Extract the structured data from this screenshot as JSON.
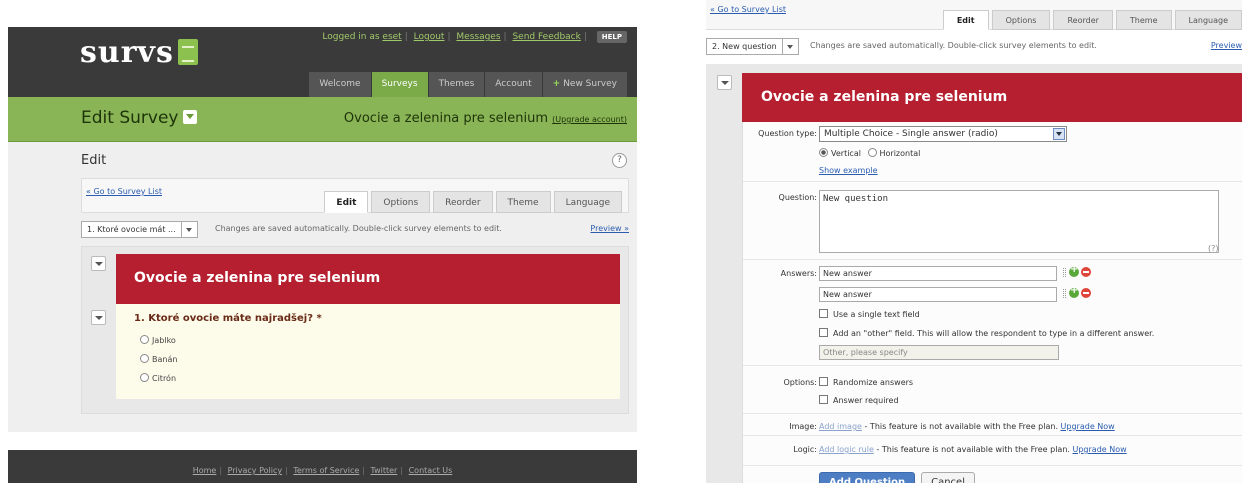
{
  "left": {
    "logo": "survs",
    "userbar": {
      "logged_in_as": "Logged in as",
      "username": "eset",
      "logout": "Logout",
      "messages": "Messages",
      "send_feedback": "Send Feedback",
      "help": "HELP"
    },
    "nav": {
      "welcome": "Welcome",
      "surveys": "Surveys",
      "themes": "Themes",
      "account": "Account",
      "new_survey_plus": "+",
      "new_survey": "New Survey"
    },
    "page_title": "Edit Survey",
    "survey_name": "Ovocie a zelenina pre selenium",
    "upgrade_link": "(Upgrade account)",
    "section_title": "Edit",
    "help_icon": "?",
    "go_to_list": "« Go to Survey List",
    "tabs": [
      "Edit",
      "Options",
      "Reorder",
      "Theme",
      "Language"
    ],
    "question_select": "1. Ktoré ovocie mát ...",
    "autosave_hint": "Changes are saved automatically. Double-click survey elements to edit.",
    "preview": "Preview »",
    "survey_header": "Ovocie a zelenina pre selenium",
    "question": "1. Ktoré ovocie máte najradšej? *",
    "answers": [
      "Jablko",
      "Banán",
      "Citrón"
    ],
    "footer": [
      "Home",
      "Privacy Policy",
      "Terms of Service",
      "Twitter",
      "Contact Us"
    ]
  },
  "right": {
    "go_to_list": "« Go to Survey List",
    "tabs": [
      "Edit",
      "Options",
      "Reorder",
      "Theme",
      "Language"
    ],
    "question_select": "2. New question",
    "autosave_hint": "Changes are saved automatically. Double-click survey elements to edit.",
    "preview": "Preview",
    "survey_header": "Ovocie a zelenina pre selenium",
    "question_type_label": "Question type:",
    "question_type_value": "Multiple Choice - Single answer (radio)",
    "orientation_vertical": "Vertical",
    "orientation_horizontal": "Horizontal",
    "show_example": "Show example",
    "question_label": "Question:",
    "question_value": "New question",
    "question_help": "(?)",
    "answers_label": "Answers:",
    "answer_values": [
      "New answer",
      "New answer"
    ],
    "single_text_field": "Use a single text field",
    "other_field": "Add an \"other\" field. This will allow the respondent to type in a different answer.",
    "other_placeholder": "Other, please specify",
    "options_label": "Options:",
    "randomize": "Randomize answers",
    "required": "Answer required",
    "image_label": "Image:",
    "add_image": "Add image",
    "image_note": " - This feature is not available with the Free plan. ",
    "logic_label": "Logic:",
    "add_logic": "Add logic rule",
    "logic_note": " - This feature is not available with the Free plan. ",
    "upgrade_now": "Upgrade Now",
    "add_question": "Add Question",
    "cancel": "Cancel"
  }
}
